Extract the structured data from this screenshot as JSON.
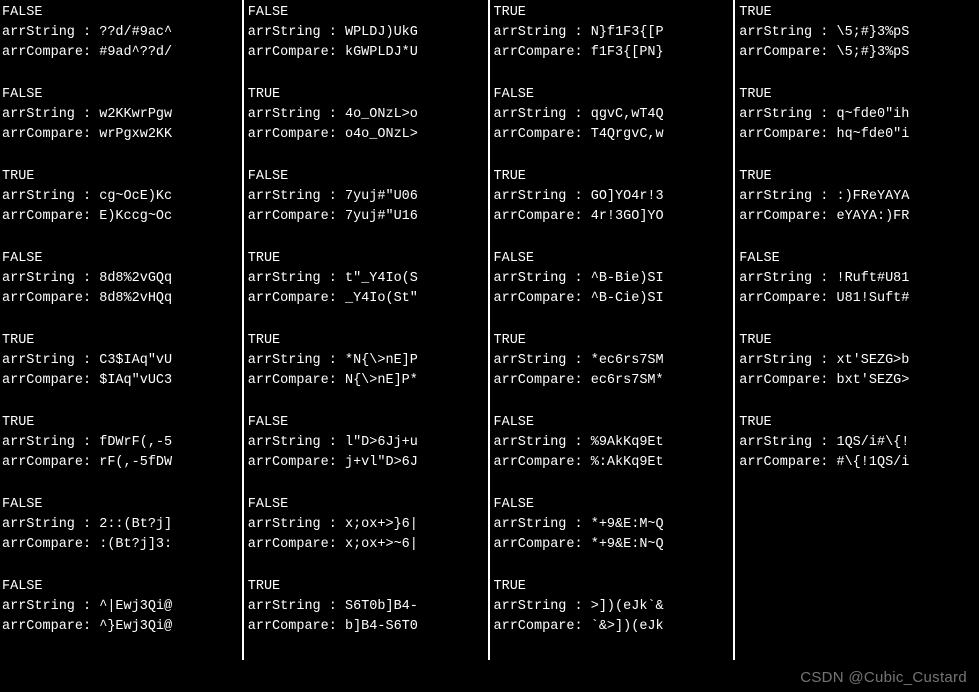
{
  "labels": {
    "str": "arrString :",
    "cmp": "arrCompare:"
  },
  "columns": [
    [
      {
        "result": "FALSE",
        "s": "??d/#9ac^",
        "c": "#9ad^??d/"
      },
      {
        "result": "FALSE",
        "s": "w2KKwrPgw",
        "c": "wrPgxw2KK"
      },
      {
        "result": "TRUE",
        "s": "cg~OcE)Kc",
        "c": "E)Kccg~Oc"
      },
      {
        "result": "FALSE",
        "s": "8d8%2vGQq",
        "c": "8d8%2vHQq"
      },
      {
        "result": "TRUE",
        "s": "C3$IAq\"vU",
        "c": "$IAq\"vUC3"
      },
      {
        "result": "TRUE",
        "s": "fDWrF(,-5",
        "c": "rF(,-5fDW"
      },
      {
        "result": "FALSE",
        "s": "2::(Bt?j]",
        "c": ":(Bt?j]3:"
      },
      {
        "result": "FALSE",
        "s": "^|Ewj3Qi@",
        "c": "^}Ewj3Qi@"
      }
    ],
    [
      {
        "result": "FALSE",
        "s": "WPLDJ)UkG",
        "c": "kGWPLDJ*U"
      },
      {
        "result": "TRUE",
        "s": "4o_ONzL>o",
        "c": "o4o_ONzL>"
      },
      {
        "result": "FALSE",
        "s": "7yuj#\"U06",
        "c": "7yuj#\"U16"
      },
      {
        "result": "TRUE",
        "s": "t\"_Y4Io(S",
        "c": "_Y4Io(St\""
      },
      {
        "result": "TRUE",
        "s": "*N{\\>nE]P",
        "c": "N{\\>nE]P*"
      },
      {
        "result": "FALSE",
        "s": "l\"D>6Jj+u",
        "c": "j+vl\"D>6J"
      },
      {
        "result": "FALSE",
        "s": "x;ox+>}6|",
        "c": "x;ox+>~6|"
      },
      {
        "result": "TRUE",
        "s": "S6T0b]B4-",
        "c": "b]B4-S6T0"
      }
    ],
    [
      {
        "result": "TRUE",
        "s": "N}f1F3{[P",
        "c": "f1F3{[PN}"
      },
      {
        "result": "FALSE",
        "s": "qgvC,wT4Q",
        "c": "T4QrgvC,w"
      },
      {
        "result": "TRUE",
        "s": "GO]YO4r!3",
        "c": "4r!3GO]YO"
      },
      {
        "result": "FALSE",
        "s": "^B-Bie)SI",
        "c": "^B-Cie)SI"
      },
      {
        "result": "TRUE",
        "s": "*ec6rs7SM",
        "c": "ec6rs7SM*"
      },
      {
        "result": "FALSE",
        "s": "%9AkKq9Et",
        "c": "%:AkKq9Et"
      },
      {
        "result": "FALSE",
        "s": "*+9&E:M~Q",
        "c": "*+9&E:N~Q"
      },
      {
        "result": "TRUE",
        "s": ">])(eJk`&",
        "c": "`&>])(eJk"
      }
    ],
    [
      {
        "result": "TRUE",
        "s": "\\5;#}3%pS",
        "c": "\\5;#}3%pS"
      },
      {
        "result": "TRUE",
        "s": "q~fde0\"ih",
        "c": "hq~fde0\"i"
      },
      {
        "result": "TRUE",
        "s": ":)FReYAYA",
        "c": "eYAYA:)FR"
      },
      {
        "result": "FALSE",
        "s": "!Ruft#U81",
        "c": "U81!Suft#"
      },
      {
        "result": "TRUE",
        "s": "xt'SEZG>b",
        "c": "bxt'SEZG>"
      },
      {
        "result": "TRUE",
        "s": "1QS/i#\\{!",
        "c": "#\\{!1QS/i"
      }
    ]
  ],
  "watermark": "CSDN @Cubic_Custard"
}
